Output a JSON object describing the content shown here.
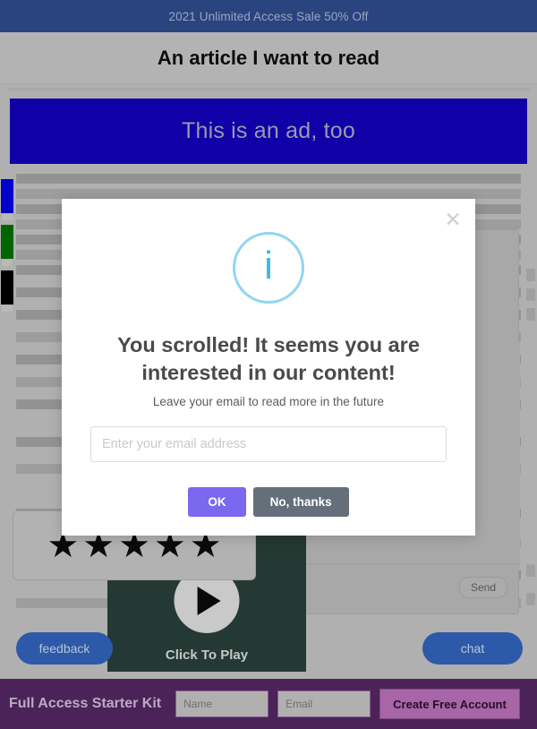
{
  "promo_banner": {
    "text": "2021 Unlimited Access Sale 50% Off",
    "background_color": "#2a4480",
    "text_color": "#9aa6bf"
  },
  "page_header": {
    "article_title": "An article I want to read"
  },
  "ad_banner": {
    "text": "This is an ad, too",
    "background_color": "#1000a8",
    "text_color": "#9a9aad"
  },
  "share_rail": {
    "buttons": [
      {
        "name": "share-blue",
        "color": "#0000c8",
        "label": ""
      },
      {
        "name": "share-green",
        "color": "#006400",
        "label": ""
      },
      {
        "name": "share-black",
        "color": "#000000",
        "label": ""
      }
    ]
  },
  "chat_panel": {
    "send_label": "Send"
  },
  "video_player": {
    "play_label": "Click To Play",
    "background_color": "#243933"
  },
  "rating_widget": {
    "stars": [
      "★",
      "★",
      "★",
      "★",
      "★"
    ],
    "rating": 5,
    "max_rating": 5
  },
  "floating_buttons": {
    "feedback_label": "feedback",
    "chat_label": "chat",
    "color": "#2c5aa8"
  },
  "footer_bar": {
    "title": "Full Access Starter Kit",
    "name_placeholder": "Name",
    "name_value": "",
    "email_placeholder": "Email",
    "email_value": "",
    "cta_label": "Create Free Account",
    "background_color": "#4b2358",
    "cta_color": "#a865a8"
  },
  "modal": {
    "close_label": "✕",
    "icon": "info-icon",
    "icon_glyph": "i",
    "icon_color": "#3db8ea",
    "heading": "You scrolled! It seems you are interested in our content!",
    "subtext": "Leave your email to read more in the future",
    "email_placeholder": "Enter your email address",
    "email_value": "",
    "ok_label": "OK",
    "decline_label": "No, thanks",
    "ok_color": "#7b68ee",
    "decline_color": "#646f7a"
  }
}
